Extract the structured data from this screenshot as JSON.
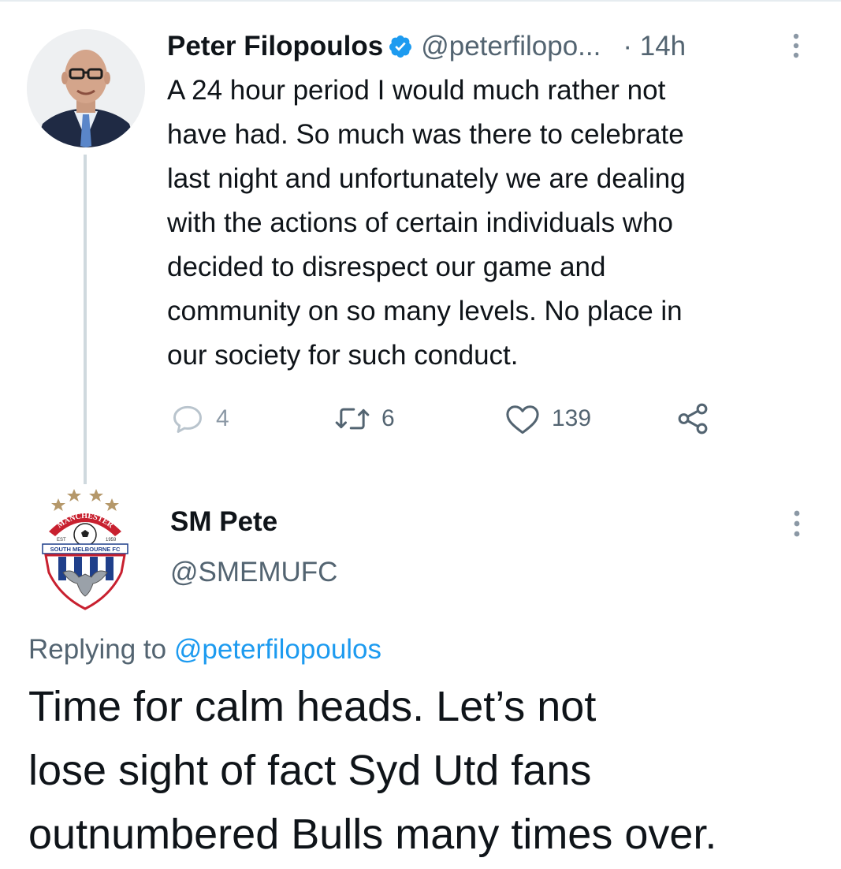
{
  "parent_tweet": {
    "author_name": "Peter Filopoulos",
    "author_handle": "@peterfilopo...",
    "time_prefix": "·",
    "time": "14h",
    "body": "A 24 hour period I would much rather not\nhave had. So much was there to celebrate\nlast night and unfortunately we are dealing\nwith the actions of certain individuals who\ndecided to disrespect our game and\ncommunity on so many levels. No place in\nour society for such conduct.",
    "replies": "4",
    "retweets": "6",
    "likes": "139",
    "verified_color": "#1d9bf0"
  },
  "reply_tweet": {
    "author_name": "SM Pete",
    "author_handle": "@SMEMUFC",
    "replying_to_label": "Replying to",
    "replying_to_handle": "@peterfilopoulos",
    "body": "Time for calm heads. Let’s not\nlose sight of fact Syd Utd fans\noutnumbered Bulls many times over.",
    "badge_text": {
      "arc": "MANCHESTER",
      "est": "EST",
      "year": "1959",
      "banner": "SOUTH MELBOURNE FC"
    }
  },
  "icons": {
    "reply": "reply-icon",
    "retweet": "retweet-icon",
    "like": "heart-icon",
    "share": "share-icon",
    "more": "more-vertical-icon",
    "verified": "verified-badge-icon"
  },
  "colors": {
    "accent": "#1d9bf0",
    "text": "#0f1419",
    "secondary": "#536471",
    "line": "#cfd9de"
  }
}
